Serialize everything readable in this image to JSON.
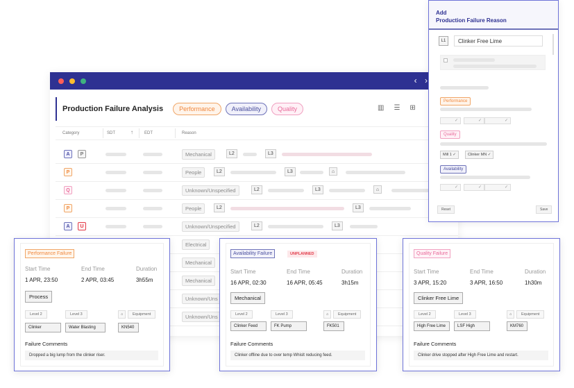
{
  "app": {
    "title": "Production Failure Analysis",
    "filters": [
      "Performance",
      "Availability",
      "Quality"
    ]
  },
  "table": {
    "headers": [
      "Category",
      "SDT",
      "EDT",
      "Reason"
    ],
    "rows": [
      {
        "cats": [
          "A",
          "P"
        ],
        "reason": "Mechanical",
        "l2": "L2",
        "l3": "L3"
      },
      {
        "cats": [
          "P"
        ],
        "reason": "People",
        "l2": "L2",
        "l3": "L3"
      },
      {
        "cats": [
          "Q"
        ],
        "reason": "Unknown/Unspecified",
        "l2": "L2",
        "l3": "L3"
      },
      {
        "cats": [
          "P"
        ],
        "reason": "People",
        "l2": "L2",
        "l3": "L3"
      },
      {
        "cats": [
          "A",
          "U"
        ],
        "reason": "Unknown/Unspecified",
        "l2": "L2",
        "l3": "L3"
      },
      {
        "cats": [],
        "reason": "Electrical"
      },
      {
        "cats": [],
        "reason": "Mechanical"
      },
      {
        "cats": [],
        "reason": "Mechanical"
      },
      {
        "cats": [],
        "reason": "Unknown/Uns"
      },
      {
        "cats": [],
        "reason": "Unknown/Uns"
      }
    ]
  },
  "panel": {
    "title_line1": "Add",
    "title_line2": "Production Failure Reason",
    "level_tag": "L1",
    "input_value": "Clinker Free Lime",
    "chips": {
      "performance": "Performance",
      "quality": "Quality",
      "availability": "Availability"
    },
    "tags": [
      "Mill 1",
      "Clinker MN"
    ],
    "reset": "Reset",
    "save": "Save"
  },
  "cards": [
    {
      "type": "Performance Failure",
      "start_label": "Start Time",
      "end_label": "End Time",
      "duration_label": "Duration",
      "start": "1 APR, 23:50",
      "end": "2 APR, 03:45",
      "duration": "3h55m",
      "reason": "Process",
      "level2_label": "Level 2",
      "level3_label": "Level 3",
      "equipment_label": "Equipment",
      "level2": "Clinker",
      "level3": "Water Blasting",
      "equipment": "KN540",
      "comments_title": "Failure Comments",
      "comment": "Dropped a big lump from the clinker riser."
    },
    {
      "type": "Availability Failure",
      "badge": "UNPLANNED",
      "start_label": "Start Time",
      "end_label": "End Time",
      "duration_label": "Duration",
      "start": "16 APR, 02:30",
      "end": "16 APR, 05:45",
      "duration": "3h15m",
      "reason": "Mechanical",
      "level2_label": "Level 2",
      "level3_label": "Level 3",
      "equipment_label": "Equipment",
      "level2": "Clinker Feed",
      "level3": "FK Pump",
      "equipment": "FK501",
      "comments_title": "Failure Comments",
      "comment": "Clinker offline due to over temp Whislt reducing feed."
    },
    {
      "type": "Quality Failure",
      "start_label": "Start Time",
      "end_label": "End Time",
      "duration_label": "Duration",
      "start": "3 APR, 15:20",
      "end": "3 APR, 16:50",
      "duration": "1h30m",
      "reason": "Clinker Free Lime",
      "level2_label": "Level 2",
      "level3_label": "Level 3",
      "equipment_label": "Equipment",
      "level2": "High Free Lime",
      "level3": "LSF High",
      "equipment": "KM760",
      "comments_title": "Failure Comments",
      "comment": "Clinker drive stopped after High Free Lime and restart."
    }
  ]
}
